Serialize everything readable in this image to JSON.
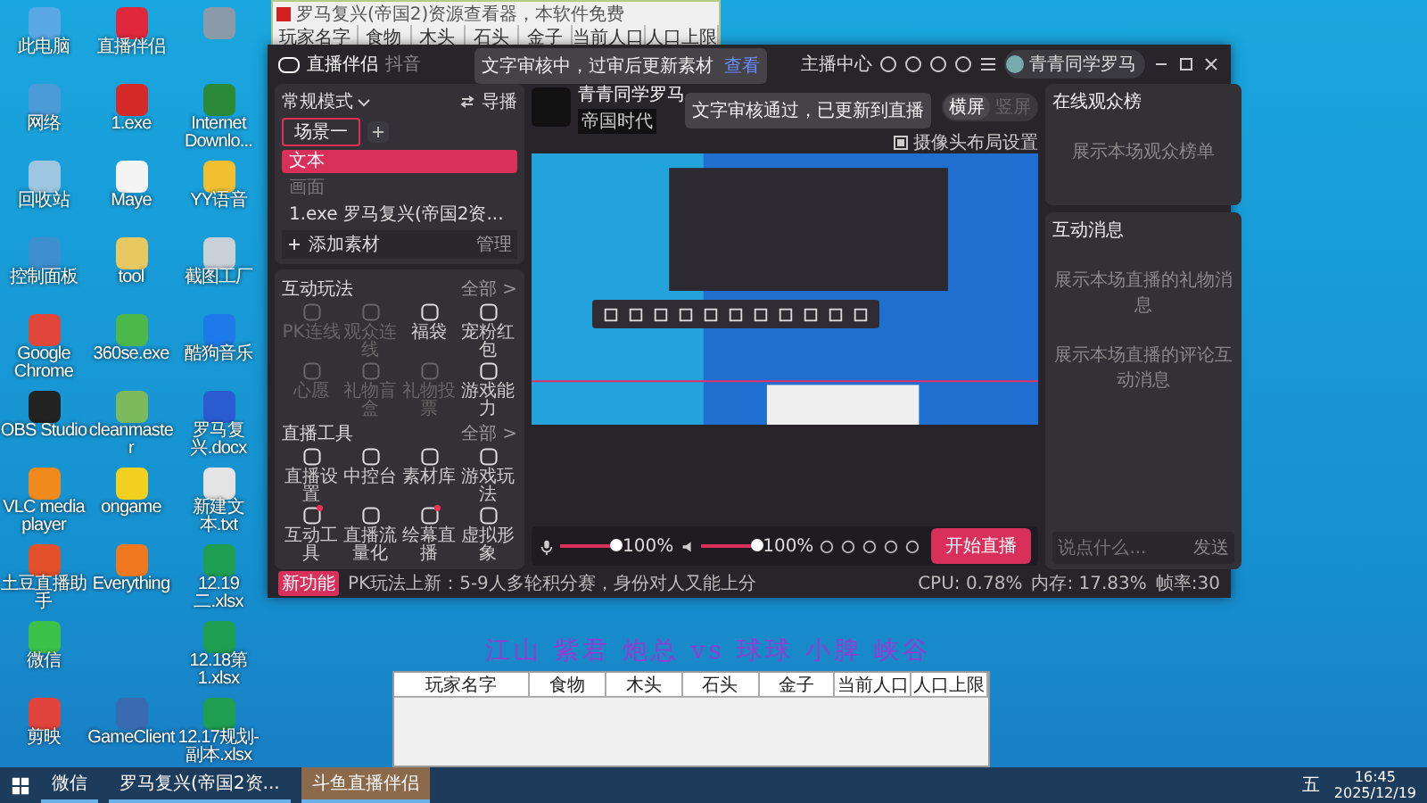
{
  "desktop_icons": [
    [
      {
        "label": "此电脑",
        "color": "#5aa7e6",
        "kind": "app"
      },
      {
        "label": "网络",
        "color": "#4a9bd8",
        "kind": "app"
      },
      {
        "label": "回收站",
        "color": "#9fc6e0",
        "kind": "app"
      },
      {
        "label": "控制面板",
        "color": "#3d8fd0",
        "kind": "app"
      },
      {
        "label": "Google Chrome",
        "color": "#e0463a",
        "kind": "app"
      },
      {
        "label": "OBS Studio",
        "color": "#222222",
        "kind": "app"
      },
      {
        "label": "VLC media player",
        "color": "#f08a1c",
        "kind": "app"
      },
      {
        "label": "土豆直播助手",
        "color": "#e2502c",
        "kind": "app"
      },
      {
        "label": "微信",
        "color": "#3cc14a",
        "kind": "app"
      },
      {
        "label": "剪映",
        "color": "#e0443c",
        "kind": "app"
      }
    ],
    [
      {
        "label": "直播伴侣",
        "color": "#e0283c",
        "kind": "app"
      },
      {
        "label": "1.exe",
        "color": "#d42a2a",
        "kind": "app"
      },
      {
        "label": "Maye",
        "color": "#f4f4f4",
        "kind": "app"
      },
      {
        "label": "tool",
        "color": "#e8c860",
        "kind": "app"
      },
      {
        "label": "360se.exe",
        "color": "#4cb84c",
        "kind": "app"
      },
      {
        "label": "cleanmaster",
        "color": "#7cb85c",
        "kind": "app"
      },
      {
        "label": "ongame",
        "color": "#f2d020",
        "kind": "app"
      },
      {
        "label": "Everything",
        "color": "#f07820",
        "kind": "app"
      },
      {
        "kind": "blank"
      },
      {
        "label": "GameClient",
        "color": "#3a6ab0",
        "kind": "app"
      }
    ],
    [
      {
        "color": "#8a9aa8",
        "kind": "icon_only"
      },
      {
        "label": "Internet Downlo...",
        "color": "#2a8a3a",
        "kind": "app"
      },
      {
        "label": "YY语音",
        "color": "#f0c030",
        "kind": "app"
      },
      {
        "label": "截图工厂",
        "color": "#c8d0d8",
        "kind": "app"
      },
      {
        "label": "酷狗音乐",
        "color": "#1e7ae8",
        "kind": "app"
      },
      {
        "label": "罗马复兴.docx",
        "color": "#2a5bd0",
        "kind": "app"
      },
      {
        "label": "新建文本.txt",
        "color": "#e4e4e4",
        "kind": "app"
      },
      {
        "label": "12.19二.xlsx",
        "color": "#1e9e50",
        "kind": "app"
      },
      {
        "label": "12.18第1.xlsx",
        "color": "#1e9e50",
        "kind": "app"
      },
      {
        "label": "12.17规划-副本.xlsx",
        "color": "#1e9e50",
        "kind": "app"
      }
    ]
  ],
  "resource_window": {
    "title": "罗马复兴(帝国2)资源查看器，本软件免费",
    "columns": [
      "玩家名字",
      "食物",
      "木头",
      "石头",
      "金子",
      "当前人口",
      "人口上限"
    ]
  },
  "live_app": {
    "title": "直播伴侣",
    "platform": "抖音",
    "toasts": [
      {
        "text": "文字审核中，过审后更新素材",
        "action": "查看"
      },
      {
        "text": "文字审核通过，已更新到直播"
      }
    ],
    "anchor_center": "主播中心",
    "user": "青青同学罗马",
    "mode": "常规模式",
    "director": "导播",
    "scenes": [
      {
        "label": "场景一",
        "selected": true
      }
    ],
    "sources": [
      {
        "label": "文本",
        "selected": true,
        "visible": true
      },
      {
        "label": "画面",
        "selected": false,
        "visible": false
      },
      {
        "label": "1.exe 罗马复兴(帝国2资...",
        "selected": false,
        "visible": true
      }
    ],
    "add_source": "添加素材",
    "manage": "管理",
    "sections": [
      {
        "title": "互动玩法",
        "more": "全部 >",
        "items": [
          {
            "label": "PK连线",
            "disabled": true,
            "dot": false
          },
          {
            "label": "观众连线",
            "disabled": true,
            "dot": false
          },
          {
            "label": "福袋",
            "disabled": false,
            "dot": false
          },
          {
            "label": "宠粉红包",
            "disabled": false,
            "dot": false
          },
          {
            "label": "心愿",
            "disabled": true,
            "dot": false
          },
          {
            "label": "礼物盲盒",
            "disabled": true,
            "dot": false
          },
          {
            "label": "礼物投票",
            "disabled": true,
            "dot": false
          },
          {
            "label": "游戏能力",
            "disabled": false,
            "dot": false
          }
        ]
      },
      {
        "title": "直播工具",
        "more": "全部 >",
        "items": [
          {
            "label": "直播设置",
            "disabled": false,
            "dot": false
          },
          {
            "label": "中控台",
            "disabled": false,
            "dot": false
          },
          {
            "label": "素材库",
            "disabled": false,
            "dot": false
          },
          {
            "label": "游戏玩法",
            "disabled": false,
            "dot": false
          },
          {
            "label": "互动工具",
            "disabled": false,
            "dot": true
          },
          {
            "label": "直播流量化",
            "disabled": false,
            "dot": false
          },
          {
            "label": "绘幕直播",
            "disabled": false,
            "dot": true
          },
          {
            "label": "虚拟形象",
            "disabled": false,
            "dot": false
          }
        ]
      }
    ],
    "streamer_name": "青青同学罗马",
    "category": "帝国时代",
    "orientation": [
      {
        "label": "横屏",
        "selected": true
      },
      {
        "label": "竖屏",
        "selected": false
      }
    ],
    "camera_layout": "摄像头布局设置",
    "mic": {
      "level": 1.0,
      "reading": "100%"
    },
    "speaker": {
      "level": 1.0,
      "reading": "100%"
    },
    "start_button": "开始直播",
    "new_badge": "新功能",
    "news": "PK玩法上新：5-9人多轮积分赛，身份对人又能上分",
    "stats": [
      "CPU: 0.78%",
      "内存: 17.83%",
      "帧率:30"
    ],
    "audience": {
      "title": "在线观众榜",
      "empty": "展示本场观众榜单"
    },
    "messages": {
      "title": "互动消息",
      "gift_empty": "展示本场直播的礼物消息",
      "comment_empty": "展示本场直播的评论互动消息",
      "placeholder": "说点什么...",
      "send": "发送"
    }
  },
  "match_title": "江山 紫君 炮总 vs 球球 小脾 峡谷",
  "table": {
    "columns": [
      "玩家名字",
      "食物",
      "木头",
      "石头",
      "金子",
      "当前人口",
      "人口上限"
    ]
  },
  "taskbar": {
    "apps": [
      {
        "label": "微信",
        "selected": false
      },
      {
        "label": "罗马复兴(帝国2资...",
        "selected": false
      },
      {
        "label": "斗鱼直播伴侣",
        "selected": true
      }
    ],
    "ime": "五",
    "time": "16:45",
    "date": "2025/12/19"
  }
}
